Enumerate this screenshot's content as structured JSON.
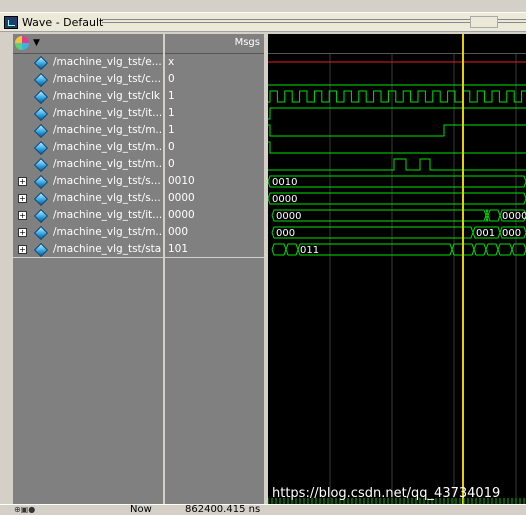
{
  "window": {
    "title": "Wave - Default"
  },
  "header": {
    "msgs_label": "Msgs"
  },
  "signals": [
    {
      "name": "/machine_vlg_tst/e...",
      "value": "x",
      "expandable": false
    },
    {
      "name": "/machine_vlg_tst/c...",
      "value": "0",
      "expandable": false
    },
    {
      "name": "/machine_vlg_tst/clk",
      "value": "1",
      "expandable": false
    },
    {
      "name": "/machine_vlg_tst/it...",
      "value": "1",
      "expandable": false
    },
    {
      "name": "/machine_vlg_tst/m...",
      "value": "1",
      "expandable": false
    },
    {
      "name": "/machine_vlg_tst/m...",
      "value": "0",
      "expandable": false
    },
    {
      "name": "/machine_vlg_tst/m...",
      "value": "0",
      "expandable": false
    },
    {
      "name": "/machine_vlg_tst/s...",
      "value": "0010",
      "expandable": true
    },
    {
      "name": "/machine_vlg_tst/s...",
      "value": "0000",
      "expandable": true
    },
    {
      "name": "/machine_vlg_tst/it...",
      "value": "0000",
      "expandable": true
    },
    {
      "name": "/machine_vlg_tst/m...",
      "value": "000",
      "expandable": true
    },
    {
      "name": "/machine_vlg_tst/sta",
      "value": "101",
      "expandable": true
    }
  ],
  "bus_labels": {
    "row7": [
      "0010"
    ],
    "row8": [
      "0000"
    ],
    "row9": [
      "0000",
      "0000"
    ],
    "row10": [
      "000",
      "001",
      "000"
    ],
    "row11": [
      "011"
    ]
  },
  "status": {
    "now_label": "Now",
    "now_value": "862400.415 ns"
  },
  "watermark": "https://blog.csdn.net/qq_43734019",
  "colors": {
    "wave_green": "#00e000",
    "cursor": "#e8d000",
    "grid": "#3a3a3a",
    "x_red": "#e02020"
  }
}
